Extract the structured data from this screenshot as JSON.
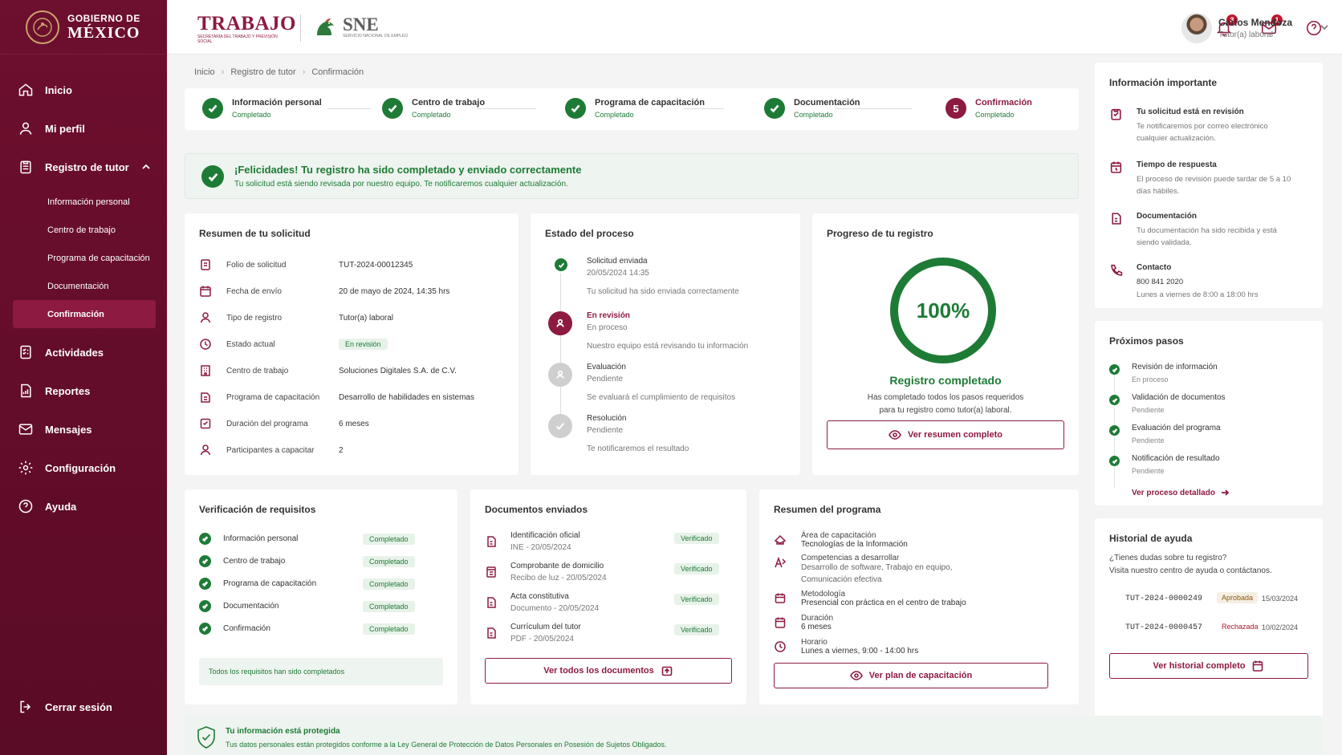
{
  "brand": {
    "line1": "GOBIERNO DE",
    "line2": "MÉXICO"
  },
  "header": {
    "trabajo_logo": "TRABAJO",
    "trabajo_sub": "SECRETARÍA DEL TRABAJO Y PREVISIÓN SOCIAL",
    "sne_logo": "SNE",
    "sne_sub": "SERVICIO NACIONAL DE EMPLEO",
    "notifications_count": "3",
    "messages_count": "1",
    "user_name": "Carlos Mendoza",
    "user_role": "Tutor(a) laboral"
  },
  "sidebar": {
    "items": [
      {
        "label": "Inicio",
        "icon": "home-icon"
      },
      {
        "label": "Mi perfil",
        "icon": "user-icon"
      },
      {
        "label": "Registro de tutor",
        "icon": "clipboard-icon"
      },
      {
        "label": "Actividades",
        "icon": "checklist-icon"
      },
      {
        "label": "Reportes",
        "icon": "report-icon"
      },
      {
        "label": "Mensajes",
        "icon": "mail-icon"
      },
      {
        "label": "Configuración",
        "icon": "gear-icon"
      },
      {
        "label": "Ayuda",
        "icon": "help-icon"
      }
    ],
    "subitems": [
      "Información personal",
      "Centro de trabajo",
      "Programa de capacitación",
      "Documentación",
      "Confirmación"
    ],
    "logout": "Cerrar sesión"
  },
  "breadcrumb": [
    "Inicio",
    "Registro de tutor",
    "Confirmación"
  ],
  "stepper": {
    "steps": [
      {
        "label": "Información personal",
        "status": "Completado"
      },
      {
        "label": "Centro de trabajo",
        "status": "Completado"
      },
      {
        "label": "Programa de capacitación",
        "status": "Completado"
      },
      {
        "label": "Documentación",
        "status": "Completado"
      },
      {
        "label": "Confirmación",
        "status": "Completado",
        "number": "5"
      }
    ]
  },
  "success": {
    "title": "¡Felicidades! Tu registro ha sido completado y enviado correctamente",
    "text": "Tu solicitud está siendo revisada por nuestro equipo. Te notificaremos cualquier actualización."
  },
  "resumen": {
    "title": "Resumen de tu solicitud",
    "rows": [
      {
        "k": "Folio de solicitud",
        "v": "TUT-2024-00012345"
      },
      {
        "k": "Fecha de envío",
        "v": "20 de mayo de 2024, 14:35 hrs"
      },
      {
        "k": "Tipo de registro",
        "v": "Tutor(a) laboral"
      },
      {
        "k": "Estado actual",
        "v": "En revisión"
      },
      {
        "k": "Centro de trabajo",
        "v": "Soluciones Digitales S.A. de C.V."
      },
      {
        "k": "Programa de capacitación",
        "v": "Desarrollo de habilidades en sistemas"
      },
      {
        "k": "Duración del programa",
        "v": "6 meses"
      },
      {
        "k": "Participantes a capacitar",
        "v": "2"
      }
    ]
  },
  "estado": {
    "title": "Estado del proceso",
    "items": [
      {
        "a": "Solicitud enviada",
        "b": "20/05/2024 14:35",
        "c": "Tu solicitud ha sido enviada correctamente"
      },
      {
        "a": "En revisión",
        "b": "En proceso",
        "c": "Nuestro equipo está revisando tu información"
      },
      {
        "a": "Evaluación",
        "b": "Pendiente",
        "c": "Se evaluará el cumplimiento de requisitos"
      },
      {
        "a": "Resolución",
        "b": "Pendiente",
        "c": "Te notificaremos el resultado"
      }
    ]
  },
  "progreso": {
    "title": "Progreso de tu registro",
    "percent": "100%",
    "percent_value": 100,
    "status": "Registro completado",
    "text": "Has completado todos los pasos requeridos para tu registro como tutor(a) laboral.",
    "button": "Ver resumen completo"
  },
  "verificacion": {
    "title": "Verificación de requisitos",
    "rows": [
      {
        "k": "Información personal",
        "v": "Completado"
      },
      {
        "k": "Centro de trabajo",
        "v": "Completado"
      },
      {
        "k": "Programa de capacitación",
        "v": "Completado"
      },
      {
        "k": "Documentación",
        "v": "Completado"
      },
      {
        "k": "Confirmación",
        "v": "Completado"
      }
    ],
    "note": "Todos los requisitos han sido completados"
  },
  "documentos": {
    "title": "Documentos enviados",
    "rows": [
      {
        "a": "Identificación oficial",
        "b": "INE - 20/05/2024",
        "v": "Verificado"
      },
      {
        "a": "Comprobante de domicilio",
        "b": "Recibo de luz - 20/05/2024",
        "v": "Verificado"
      },
      {
        "a": "Acta constitutiva",
        "b": "Documento - 20/05/2024",
        "v": "Verificado"
      },
      {
        "a": "Currículum del tutor",
        "b": "PDF - 20/05/2024",
        "v": "Verificado"
      }
    ],
    "button": "Ver todos los documentos"
  },
  "programa": {
    "title": "Resumen del programa",
    "rows": [
      {
        "a": "Área de capacitación",
        "b": "Tecnologías de la Información"
      },
      {
        "a": "Competencias a desarrollar",
        "b": "Desarrollo de software, Trabajo en equipo, Comunicación efectiva"
      },
      {
        "a": "Metodología",
        "b": "Presencial con práctica en el centro de trabajo"
      },
      {
        "a": "Duración",
        "b": "6 meses"
      },
      {
        "a": "Horario",
        "b": "Lunes a viernes, 9:00 - 14:00 hrs"
      }
    ],
    "button": "Ver plan de capacitación"
  },
  "info": {
    "title": "Información importante",
    "rows": [
      {
        "a": "Tu solicitud está en revisión",
        "b": "Te notificaremos por correo electrónico cualquier actualización."
      },
      {
        "a": "Tiempo de respuesta",
        "b": "El proceso de revisión puede tardar de 5 a 10 días hábiles."
      },
      {
        "a": "Documentación",
        "b": "Tu documentación ha sido recibida y está siendo validada."
      },
      {
        "a": "Contacto",
        "b": "800 841 2020",
        "c": "Lunes a viernes de 8:00 a 18:00 hrs"
      }
    ]
  },
  "pasos": {
    "title": "Próximos pasos",
    "rows": [
      {
        "a": "Revisión de información",
        "b": "En proceso"
      },
      {
        "a": "Validación de documentos",
        "b": "Pendiente"
      },
      {
        "a": "Evaluación del programa",
        "b": "Pendiente"
      },
      {
        "a": "Notificación de resultado",
        "b": "Pendiente"
      }
    ],
    "link": "Ver proceso detallado"
  },
  "historial": {
    "title": "Historial de ayuda",
    "d1": "¿Tienes dudas sobre tu registro?",
    "d2": "Visita nuestro centro de ayuda o contáctanos.",
    "rows": [
      {
        "id": "TUT-2024-0000249",
        "status": "Aprobada",
        "date": "15/03/2024"
      },
      {
        "id": "TUT-2024-0000457",
        "status": "Rechazada",
        "date": "10/02/2024"
      }
    ],
    "button": "Ver historial completo"
  },
  "protect": {
    "title": "Tu información está protegida",
    "text": "Tus datos personales están protegidos conforme a la Ley General de Protección de Datos Personales en Posesión de Sujetos Obligados."
  },
  "colors": {
    "primary": "#8d1a40",
    "success": "#1e7b36",
    "sidebar": "#6d0f2e"
  }
}
